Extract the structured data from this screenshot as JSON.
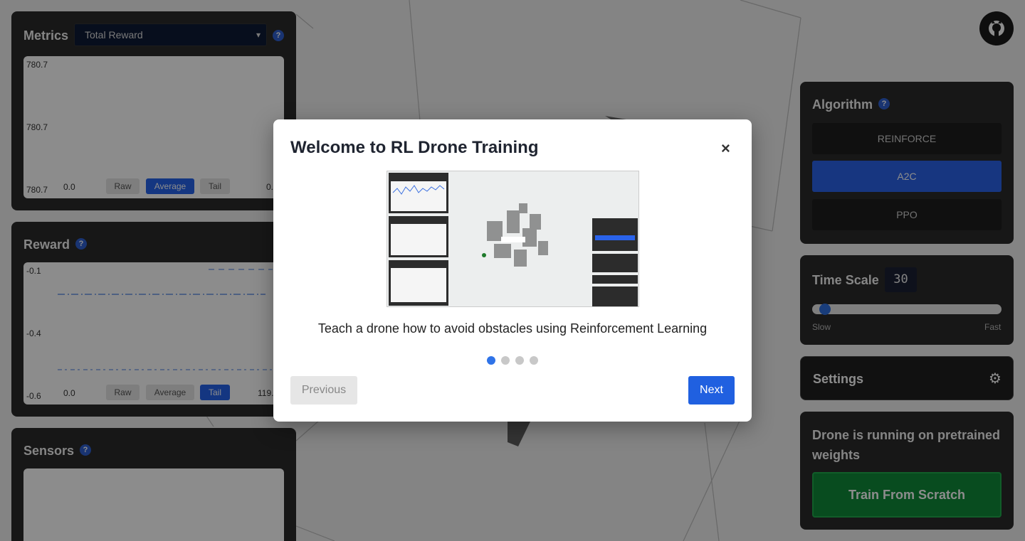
{
  "metrics_panel": {
    "title": "Metrics",
    "select_value": "Total Reward",
    "y_ticks": [
      "780.7",
      "780.7",
      "780.7"
    ],
    "x_start": "0.0",
    "x_end": "0.",
    "modes": [
      "Raw",
      "Average",
      "Tail"
    ],
    "active_mode": "Average"
  },
  "reward_panel": {
    "title": "Reward",
    "y_ticks": [
      "-0.1",
      "-0.4",
      "-0.6"
    ],
    "x_start": "0.0",
    "x_end": "119.",
    "modes": [
      "Raw",
      "Average",
      "Tail"
    ],
    "active_mode": "Tail"
  },
  "sensors_panel": {
    "title": "Sensors"
  },
  "algorithm_panel": {
    "title": "Algorithm",
    "options": [
      "REINFORCE",
      "A2C",
      "PPO"
    ],
    "active": "A2C"
  },
  "time_scale_panel": {
    "title": "Time Scale",
    "value": "30",
    "slow_label": "Slow",
    "fast_label": "Fast",
    "level": 0.04
  },
  "settings_panel": {
    "title": "Settings"
  },
  "training_panel": {
    "status": "Drone is running on pretrained weights",
    "button_label": "Train From Scratch"
  },
  "modal": {
    "title": "Welcome to RL Drone Training",
    "close_label": "×",
    "description": "Teach a drone how to avoid obstacles using Reinforcement Learning",
    "step": 1,
    "total_steps": 4,
    "prev_label": "Previous",
    "next_label": "Next"
  },
  "colors": {
    "accent": "#2563eb",
    "panel": "#2b2b2b",
    "train": "#0f8a3a"
  }
}
